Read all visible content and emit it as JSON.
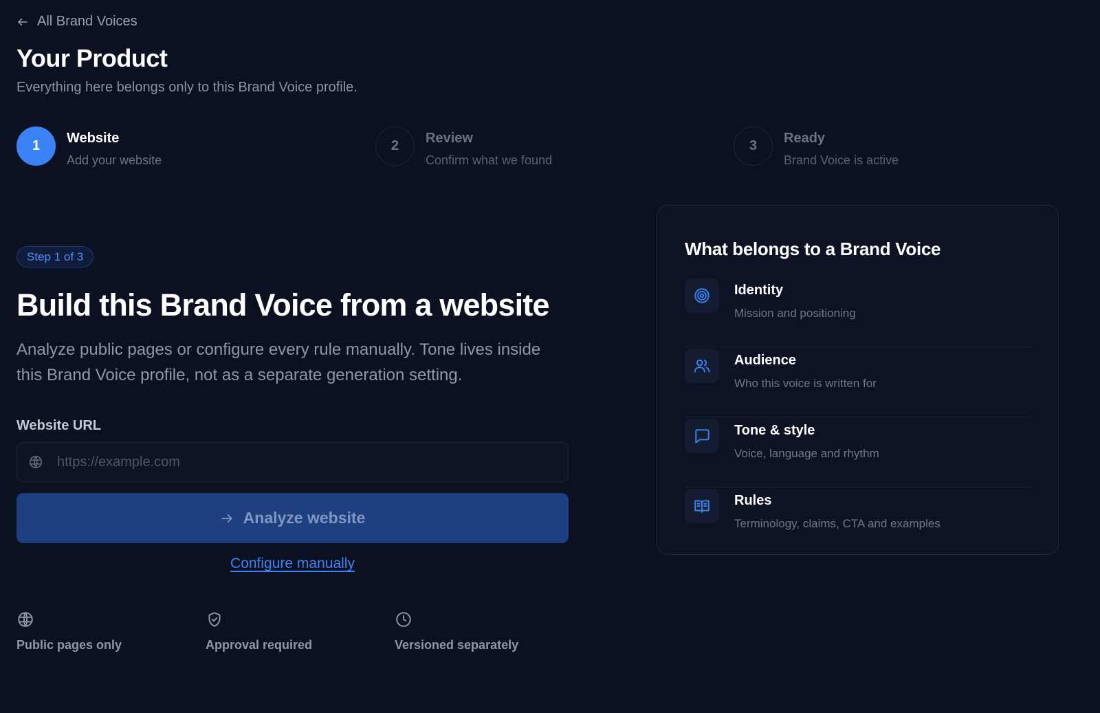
{
  "header": {
    "back_label": "All Brand Voices",
    "title": "Your Product",
    "subtitle": "Everything here belongs only to this Brand Voice profile."
  },
  "stepper": {
    "steps": [
      {
        "number": "1",
        "label": "Website",
        "description": "Add your website"
      },
      {
        "number": "2",
        "label": "Review",
        "description": "Confirm what we found"
      },
      {
        "number": "3",
        "label": "Ready",
        "description": "Brand Voice is active"
      }
    ],
    "active_index": 0
  },
  "main": {
    "badge": "Step 1 of 3",
    "heading": "Build this Brand Voice from a website",
    "description": "Analyze public pages or configure every rule manually. Tone lives inside this Brand Voice profile, not as a separate generation setting.",
    "url_label": "Website URL",
    "url_value": "",
    "url_placeholder": "https://example.com",
    "analyze_label": "Analyze website",
    "configure_label": "Configure manually"
  },
  "features": [
    {
      "icon": "globe-icon",
      "label": "Public pages only"
    },
    {
      "icon": "shield-check-icon",
      "label": "Approval required"
    },
    {
      "icon": "clock-icon",
      "label": "Versioned separately"
    }
  ],
  "card": {
    "title": "What belongs to a Brand Voice",
    "items": [
      {
        "icon": "target-icon",
        "title": "Identity",
        "description": "Mission and positioning"
      },
      {
        "icon": "users-icon",
        "title": "Audience",
        "description": "Who this voice is written for"
      },
      {
        "icon": "message-icon",
        "title": "Tone & style",
        "description": "Voice, language and rhythm"
      },
      {
        "icon": "book-icon",
        "title": "Rules",
        "description": "Terminology, claims, CTA and examples"
      }
    ]
  },
  "colors": {
    "background": "#0b1120",
    "accent": "#3b82f6",
    "button_disabled": "#1f4080",
    "card_background": "#0d1322"
  }
}
